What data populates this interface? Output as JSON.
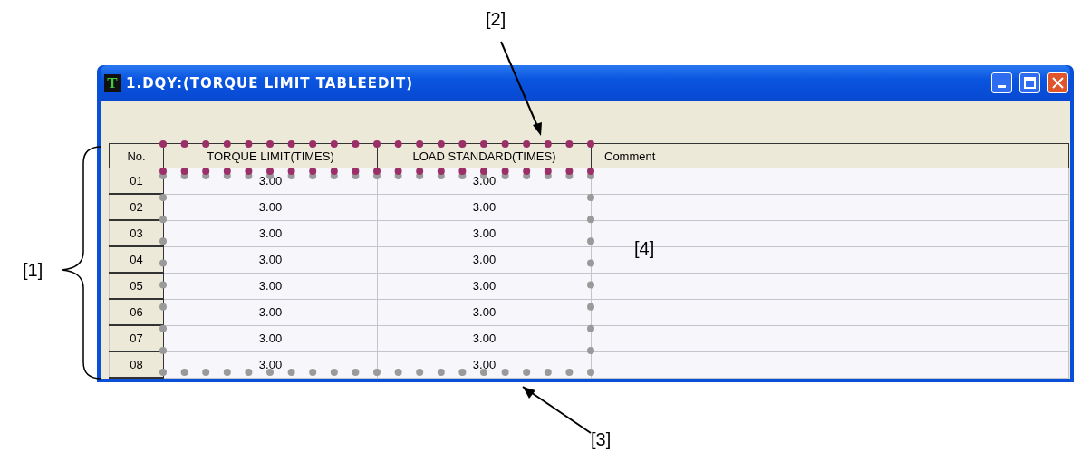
{
  "window": {
    "title": "1.DQY:(TORQUE LIMIT TABLEEDIT)",
    "icon_letter": "T"
  },
  "table": {
    "columns": [
      "No.",
      "TORQUE LIMIT(TIMES)",
      "LOAD STANDARD(TIMES)",
      "Comment"
    ],
    "rows": [
      {
        "no": "01",
        "torque_limit": "3.00",
        "load_standard": "3.00"
      },
      {
        "no": "02",
        "torque_limit": "3.00",
        "load_standard": "3.00"
      },
      {
        "no": "03",
        "torque_limit": "3.00",
        "load_standard": "3.00"
      },
      {
        "no": "04",
        "torque_limit": "3.00",
        "load_standard": "3.00"
      },
      {
        "no": "05",
        "torque_limit": "3.00",
        "load_standard": "3.00"
      },
      {
        "no": "06",
        "torque_limit": "3.00",
        "load_standard": "3.00"
      },
      {
        "no": "07",
        "torque_limit": "3.00",
        "load_standard": "3.00"
      },
      {
        "no": "08",
        "torque_limit": "3.00",
        "load_standard": "3.00"
      }
    ]
  },
  "highlights": [
    {
      "color": "#9b3068"
    },
    {
      "color": "#9a9a9a"
    }
  ],
  "callouts": [
    "[1]",
    "[2]",
    "[3]",
    "[4]"
  ]
}
